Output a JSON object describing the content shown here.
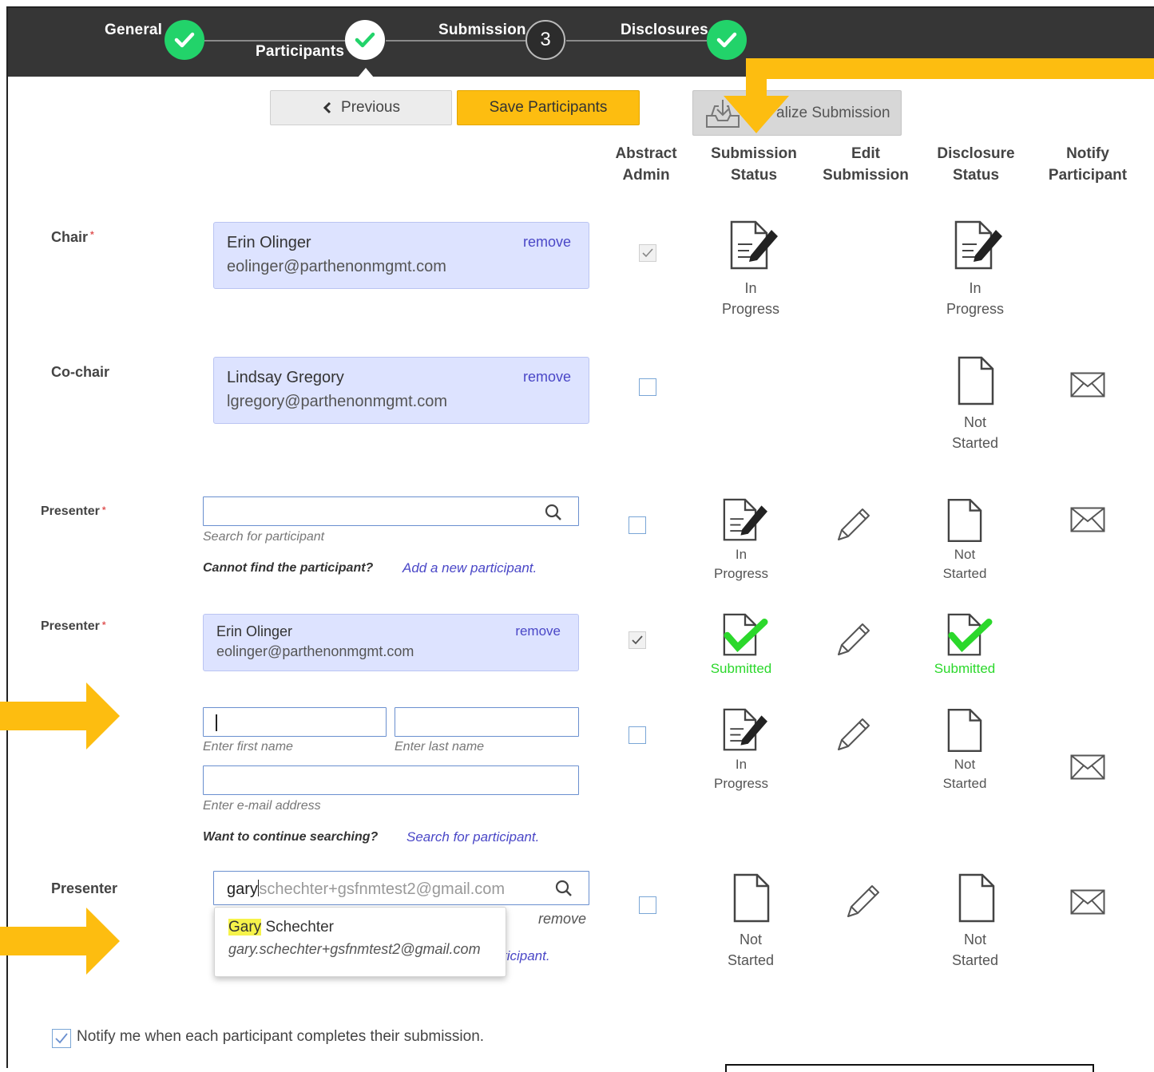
{
  "wizard": {
    "steps": [
      {
        "label": "General",
        "state": "done"
      },
      {
        "label": "Participants",
        "state": "current"
      },
      {
        "label": "Submission",
        "state": "pending",
        "number": "3"
      },
      {
        "label": "Disclosures",
        "state": "done"
      }
    ]
  },
  "toolbar": {
    "previous_label": "Previous",
    "save_label": "Save Participants",
    "finalize_label": "alize Submission"
  },
  "columns": {
    "abstract_admin": [
      "Abstract",
      "Admin"
    ],
    "submission_status": [
      "Submission",
      "Status"
    ],
    "edit_submission": [
      "Edit",
      "Submission"
    ],
    "disclosure_status": [
      "Disclosure",
      "Status"
    ],
    "notify_participant": [
      "Notify",
      "Participant"
    ]
  },
  "rows": {
    "chair": {
      "role": "Chair",
      "name": "Erin Olinger",
      "email": "eolinger@parthenonmgmt.com",
      "remove": "remove",
      "submission_status": [
        "In",
        "Progress"
      ],
      "disclosure_status": [
        "In",
        "Progress"
      ]
    },
    "cochair": {
      "role": "Co-chair",
      "name": "Lindsay Gregory",
      "email": "lgregory@parthenonmgmt.com",
      "remove": "remove",
      "disclosure_status": [
        "Not",
        "Started"
      ]
    },
    "presenter1": {
      "role": "Presenter",
      "search_hint": "Search for participant",
      "cannot_find": "Cannot find the participant?",
      "add_new": "Add a new participant.",
      "submission_status": [
        "In",
        "Progress"
      ],
      "disclosure_status": [
        "Not",
        "Started"
      ]
    },
    "presenter2": {
      "role": "Presenter",
      "name": "Erin Olinger",
      "email": "eolinger@parthenonmgmt.com",
      "remove": "remove",
      "submission_status": "Submitted",
      "disclosure_status": "Submitted"
    },
    "presenter3": {
      "first_name_hint": "Enter first name",
      "last_name_hint": "Enter last name",
      "email_hint": "Enter e-mail address",
      "continue_q": "Want to continue searching?",
      "search_link": "Search for participant.",
      "submission_status": [
        "In",
        "Progress"
      ],
      "disclosure_status": [
        "Not",
        "Started"
      ]
    },
    "presenter4": {
      "role": "Presenter",
      "typed": "gary",
      "autocomplete": "schechter+gsfnmtest2@gmail.com",
      "remove": "remove",
      "link_tail": "ticipant.",
      "submission_status": [
        "Not",
        "Started"
      ],
      "disclosure_status": [
        "Not",
        "Started"
      ],
      "suggestion": {
        "highlight": "Gary",
        "rest": " Schechter",
        "email": "gary.schechter+gsfnmtest2@gmail.com"
      }
    }
  },
  "notify_me": "Notify me when each participant completes their submission.",
  "colors": {
    "accent": "#fdbd10",
    "done": "#22d36a",
    "link": "#4a47c7",
    "card": "#dde3ff",
    "submitted": "#2bd82b"
  }
}
